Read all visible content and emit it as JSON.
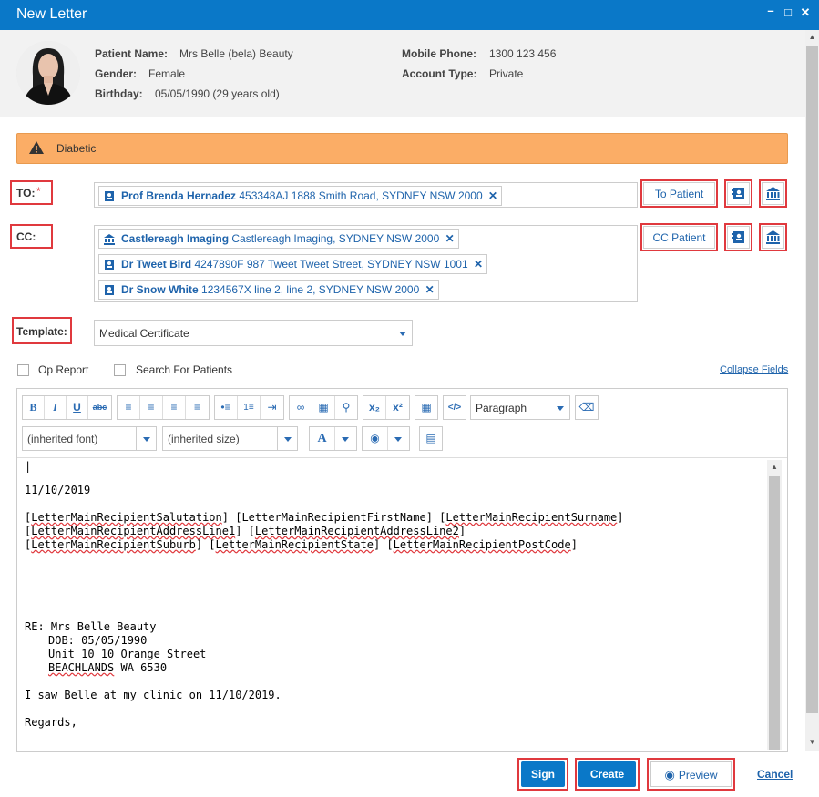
{
  "window": {
    "title": "New Letter"
  },
  "patient": {
    "name_label": "Patient Name:",
    "name": "Mrs Belle (bela) Beauty",
    "gender_label": "Gender:",
    "gender": "Female",
    "birthday_label": "Birthday:",
    "birthday": "05/05/1990 (29 years old)",
    "mobile_label": "Mobile Phone:",
    "mobile": "1300 123 456",
    "account_label": "Account Type:",
    "account": "Private"
  },
  "alert": {
    "text": "Diabetic",
    "color": "#fbad66"
  },
  "to": {
    "label": "TO:",
    "required_mark": "*",
    "recipients": [
      {
        "name": "Prof Brenda Hernadez",
        "detail": "453348AJ 1888 Smith Road, SYDNEY NSW 2000",
        "icon": "contact-card-icon"
      }
    ],
    "patient_button": "To Patient"
  },
  "cc": {
    "label": "CC:",
    "recipients": [
      {
        "name": "Castlereagh Imaging",
        "detail": "Castlereagh Imaging, SYDNEY NSW 2000",
        "icon": "institution-icon"
      },
      {
        "name": "Dr Tweet Bird",
        "detail": "4247890F 987 Tweet Tweet Street, SYDNEY NSW 1001",
        "icon": "contact-card-icon"
      },
      {
        "name": "Dr Snow White",
        "detail": "1234567X line 2, line 2, SYDNEY NSW 2000",
        "icon": "contact-card-icon"
      }
    ],
    "patient_button": "CC Patient"
  },
  "template": {
    "label": "Template:",
    "value": "Medical Certificate"
  },
  "options": {
    "op_report": "Op Report",
    "search_patients": "Search For Patients",
    "collapse": "Collapse Fields"
  },
  "editor": {
    "format_value": "Paragraph",
    "font_value": "(inherited font)",
    "size_value": "(inherited size)",
    "lines": {
      "date": "11/10/2019",
      "l1a": "LetterMainRecipientSalutation",
      "l1b": "LetterMainRecipientFirstName",
      "l1c": "LetterMainRecipientSurname",
      "l2a": "LetterMainRecipientAddressLine1",
      "l2b": "LetterMainRecipientAddressLine2",
      "l3a": "LetterMainRecipientSuburb",
      "l3b": "LetterMainRecipientState",
      "l3c": "LetterMainRecipientPostCode",
      "re": "RE: Mrs Belle Beauty",
      "dob": "DOB: 05/05/1990",
      "addr": "Unit 10 10 Orange Street",
      "suburb": "BEACHLANDS",
      "suburb_rest": " WA 6530",
      "saw": "I saw Belle at my clinic on 11/10/2019.",
      "regards": "Regards,"
    }
  },
  "footer": {
    "sign": "Sign",
    "create": "Create",
    "preview": "Preview",
    "cancel": "Cancel"
  }
}
